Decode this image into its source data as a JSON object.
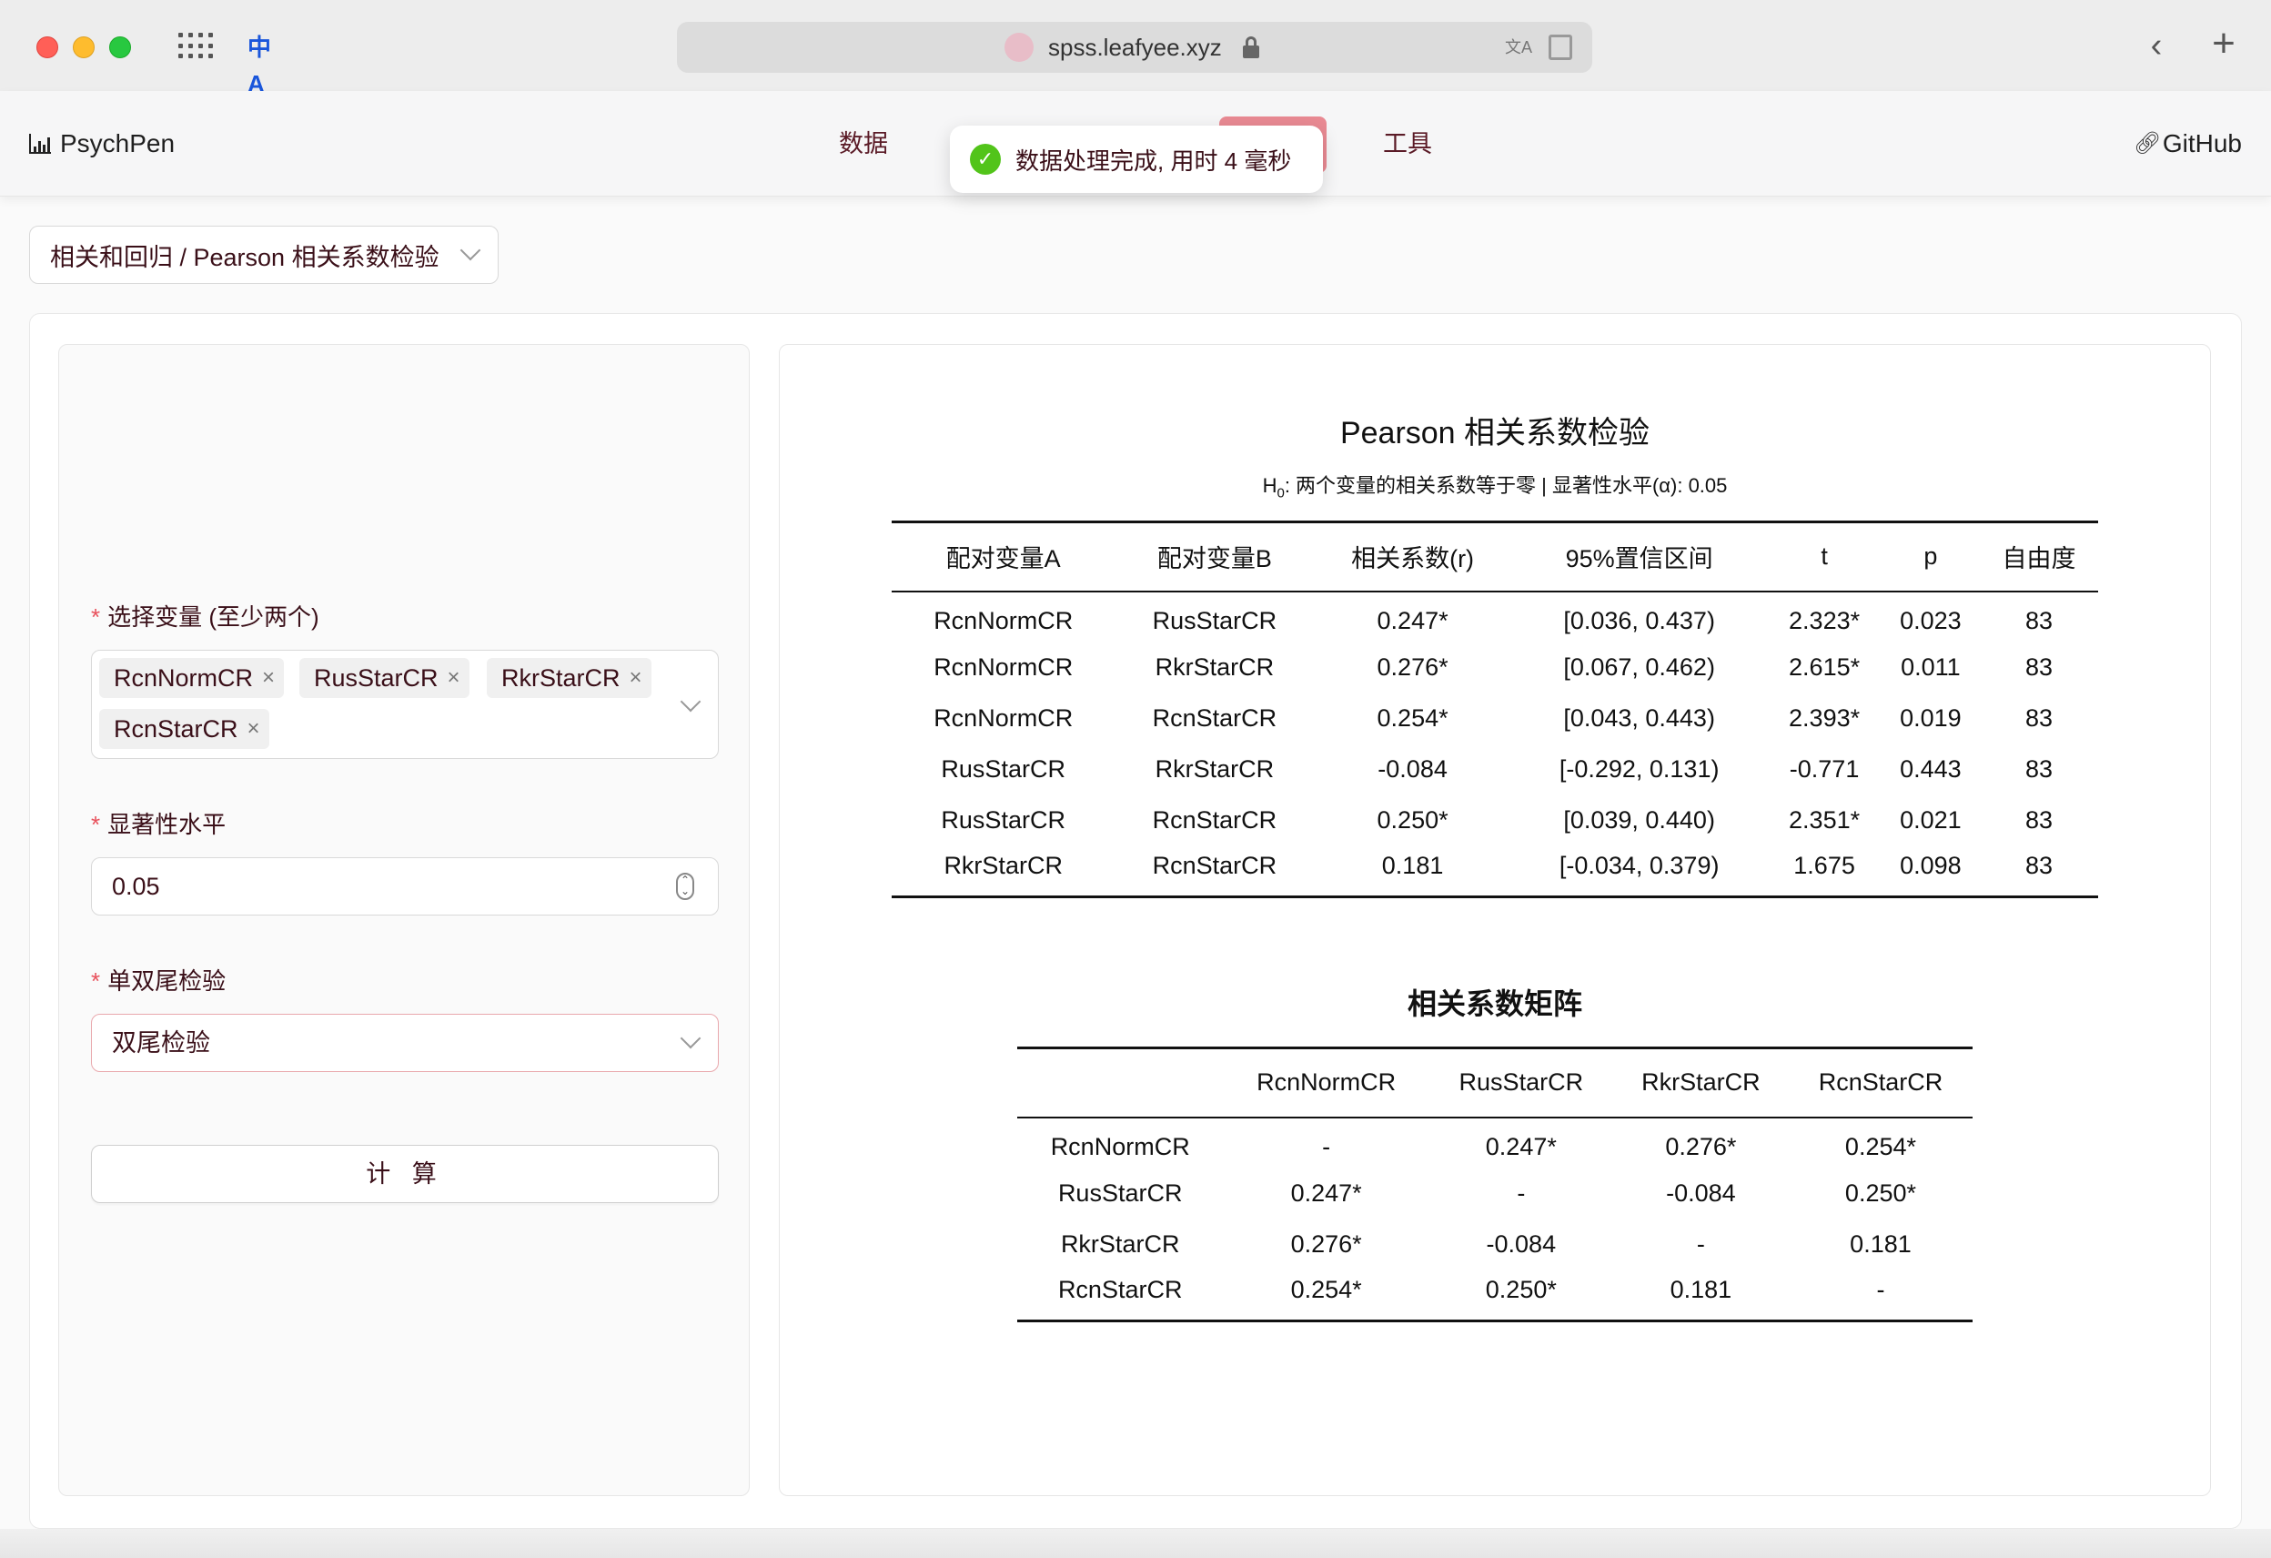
{
  "browser": {
    "url": "spss.leafyee.xyz"
  },
  "navbar": {
    "brand": "PsychPen",
    "items": [
      "数据",
      "工具"
    ],
    "github": "GitHub"
  },
  "toast": {
    "message": "数据处理完成, 用时 4 毫秒"
  },
  "method_selector": {
    "value": "相关和回归 / Pearson 相关系数检验"
  },
  "form": {
    "variables_label": "选择变量 (至少两个)",
    "selected_variables": [
      "RcnNormCR",
      "RusStarCR",
      "RkrStarCR",
      "RcnStarCR"
    ],
    "alpha_label": "显著性水平",
    "alpha_value": "0.05",
    "tail_label": "单双尾检验",
    "tail_value": "双尾检验",
    "calculate_label": "计 算"
  },
  "results": {
    "title": "Pearson 相关系数检验",
    "hypothesis_prefix": "H",
    "hypothesis_sub": "0",
    "hypothesis_rest": ": 两个变量的相关系数等于零 | 显著性水平(α): 0.05",
    "pairs_headers": [
      "配对变量A",
      "配对变量B",
      "相关系数(r)",
      "95%置信区间",
      "t",
      "p",
      "自由度"
    ],
    "pairs_rows": [
      [
        "RcnNormCR",
        "RusStarCR",
        "0.247*",
        "[0.036, 0.437)",
        "2.323*",
        "0.023",
        "83"
      ],
      [
        "RcnNormCR",
        "RkrStarCR",
        "0.276*",
        "[0.067, 0.462)",
        "2.615*",
        "0.011",
        "83"
      ],
      [
        "RcnNormCR",
        "RcnStarCR",
        "0.254*",
        "[0.043, 0.443)",
        "2.393*",
        "0.019",
        "83"
      ],
      [
        "RusStarCR",
        "RkrStarCR",
        "-0.084",
        "[-0.292, 0.131)",
        "-0.771",
        "0.443",
        "83"
      ],
      [
        "RusStarCR",
        "RcnStarCR",
        "0.250*",
        "[0.039, 0.440)",
        "2.351*",
        "0.021",
        "83"
      ],
      [
        "RkrStarCR",
        "RcnStarCR",
        "0.181",
        "[-0.034, 0.379)",
        "1.675",
        "0.098",
        "83"
      ]
    ],
    "matrix_title": "相关系数矩阵",
    "matrix_headers": [
      "",
      "RcnNormCR",
      "RusStarCR",
      "RkrStarCR",
      "RcnStarCR"
    ],
    "matrix_rows": [
      [
        "RcnNormCR",
        "-",
        "0.247*",
        "0.276*",
        "0.254*"
      ],
      [
        "RusStarCR",
        "0.247*",
        "-",
        "-0.084",
        "0.250*"
      ],
      [
        "RkrStarCR",
        "0.276*",
        "-0.084",
        "-",
        "0.181"
      ],
      [
        "RcnStarCR",
        "0.254*",
        "0.250*",
        "0.181",
        "-"
      ]
    ]
  },
  "colors": {
    "accent": "#e98a93",
    "text": "#3a0f18",
    "success": "#52c41a"
  }
}
